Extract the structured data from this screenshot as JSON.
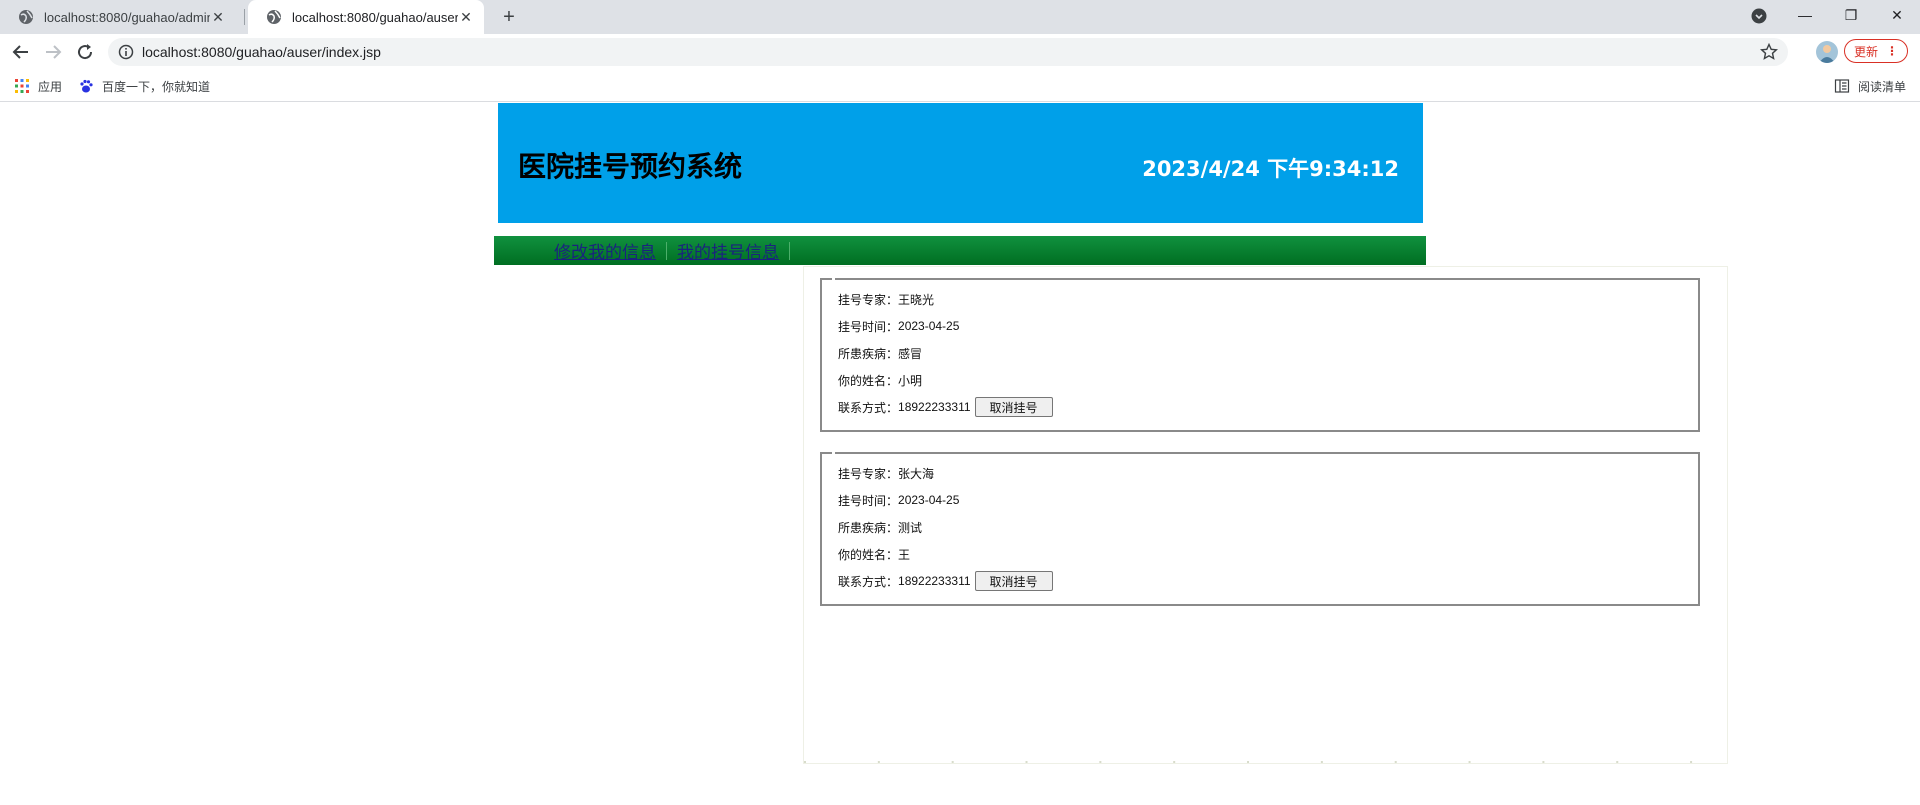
{
  "browser": {
    "tabs": [
      {
        "title": "localhost:8080/guahao/admin/",
        "active": false
      },
      {
        "title": "localhost:8080/guahao/auser/i",
        "active": true
      }
    ],
    "url": "localhost:8080/guahao/auser/index.jsp",
    "update_label": "更新",
    "bookmarks": [
      {
        "label": "应用",
        "icon": "apps-grid-icon"
      },
      {
        "label": "百度一下，你就知道",
        "icon": "baidu-paw-icon"
      }
    ],
    "reading_list": "阅读清单"
  },
  "header": {
    "title": "医院挂号预约系统",
    "clock": "2023/4/24 下午9:34:12"
  },
  "nav": {
    "items": [
      "修改我的信息",
      "我的挂号信息"
    ]
  },
  "labels": {
    "expert": "挂号专家：",
    "time": "挂号时间：",
    "disease": "所患疾病：",
    "name": "你的姓名：",
    "contact": "联系方式："
  },
  "appointments": [
    {
      "expert": "王晓光",
      "time": "2023-04-25",
      "disease": "感冒",
      "name": "小明",
      "contact": "18922233311",
      "cancel_label": "取消挂号"
    },
    {
      "expert": "张大海",
      "time": "2023-04-25",
      "disease": "测试",
      "name": "王",
      "contact": "18922233311",
      "cancel_label": "取消挂号"
    }
  ]
}
